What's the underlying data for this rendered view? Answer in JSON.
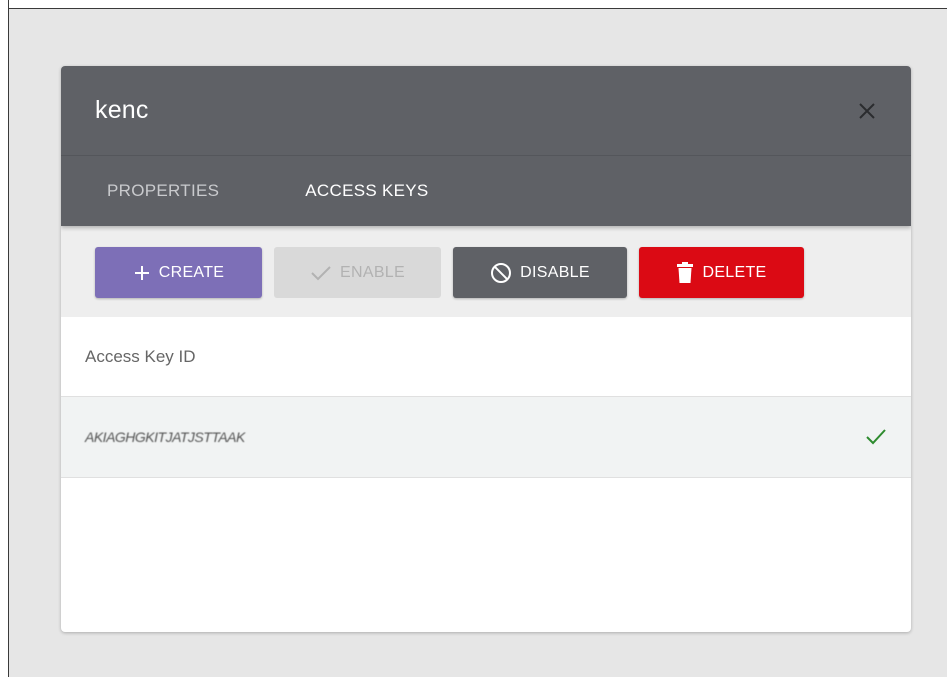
{
  "dialog": {
    "title": "kenc",
    "close_icon": "close-icon"
  },
  "tabs": [
    {
      "label": "PROPERTIES",
      "active": false
    },
    {
      "label": "ACCESS KEYS",
      "active": true
    }
  ],
  "toolbar": {
    "create_label": "CREATE",
    "enable_label": "ENABLE",
    "disable_label": "DISABLE",
    "delete_label": "DELETE"
  },
  "table": {
    "column_header": "Access Key ID",
    "rows": [
      {
        "key_id": "AKIAGHGKITJATJSTTAAK",
        "status": "enabled",
        "status_icon": "check-icon"
      }
    ]
  },
  "colors": {
    "header_bg": "#5f6166",
    "create": "#7d6fb7",
    "enable_disabled": "#d9d9d9",
    "disable": "#5f6166",
    "delete": "#db0a14",
    "check": "#2e8b2e"
  }
}
